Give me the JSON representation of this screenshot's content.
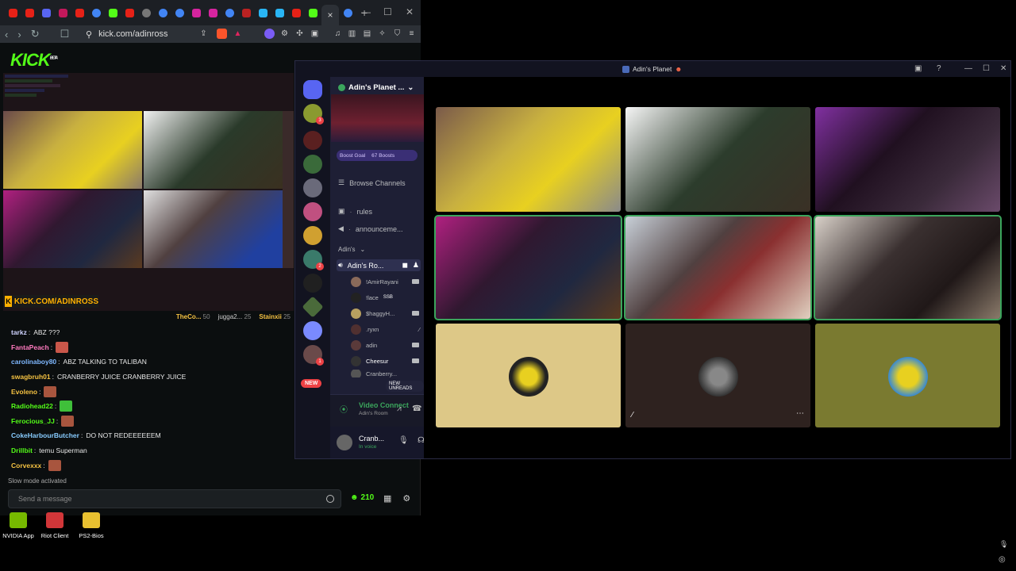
{
  "browser": {
    "url": "kick.com/adinross",
    "tab_close": "×",
    "tab_add": "+"
  },
  "kick": {
    "logo": "KICK",
    "logo_badge": "BETA",
    "banner": "KICK.COM/ADINROSS",
    "leaderboard": [
      {
        "name": "TheCo...",
        "value": "50"
      },
      {
        "name": "jugga2...",
        "value": "25"
      },
      {
        "name": "Stainxii",
        "value": "25"
      }
    ],
    "chat": [
      {
        "user": "tarkz",
        "color": "#cfd3ff",
        "text": "ABZ ???",
        "emote": ""
      },
      {
        "user": "FantaPeach",
        "color": "#ff7abf",
        "text": "",
        "emote": "#c9574a"
      },
      {
        "user": "carolinaboy80",
        "color": "#7fb8ff",
        "text": "ABZ TALKING TO TALIBAN",
        "emote": ""
      },
      {
        "user": "swagbruh01",
        "color": "#f5c242",
        "text": "CRANBERRY JUICE CRANBERRY JUICE",
        "emote": ""
      },
      {
        "user": "Evoleno",
        "color": "#f5c242",
        "text": "",
        "emote": "#a8553e"
      },
      {
        "user": "Radiohead22",
        "color": "#53fc18",
        "text": "",
        "emote": "#3fbf3a"
      },
      {
        "user": "Ferocious_JJ",
        "color": "#53fc18",
        "text": "",
        "emote": "#a8553e"
      },
      {
        "user": "CokeHarbourButcher",
        "color": "#88ccff",
        "text": "DO NOT REDEEEEEEM",
        "emote": ""
      },
      {
        "user": "Drillbit",
        "color": "#53fc18",
        "text": "temu Superman",
        "emote": ""
      },
      {
        "user": "Corvexxx",
        "color": "#f5c242",
        "text": "",
        "emote": "#a8553e"
      }
    ],
    "slow_mode": "Slow mode activated",
    "input_placeholder": "Send a message",
    "viewers": "210"
  },
  "desktop_icons": [
    {
      "label": "NVIDIA App",
      "color": "#76b900"
    },
    {
      "label": "Riot Client",
      "color": "#d13639"
    },
    {
      "label": "PS2-Bios",
      "color": "#e8c030"
    }
  ],
  "discord": {
    "window_title": "Adin's Planet",
    "server_name": "Adin's Planet ...",
    "boost_goal": "Boost Goal",
    "boosts": "67 Boosts",
    "browse_channels": "Browse Channels",
    "channels": [
      "rules",
      "announceme..."
    ],
    "category": "Adin's",
    "voice_channel": "Adin's Ro...",
    "voice_users": [
      "!AmirRayani",
      "!lace",
      "$haggyH...",
      ".ryxn",
      "adin",
      "Cheesur",
      "Cranberry..."
    ],
    "lace_tag": "SSB",
    "new_unreads": "NEW UNREADS",
    "new_label": "NEW",
    "video_connected": "Video Connect",
    "video_room": "Adin's Room",
    "username": "Cranb...",
    "user_status": "In voice",
    "badges": [
      "3",
      "2",
      "1"
    ]
  }
}
